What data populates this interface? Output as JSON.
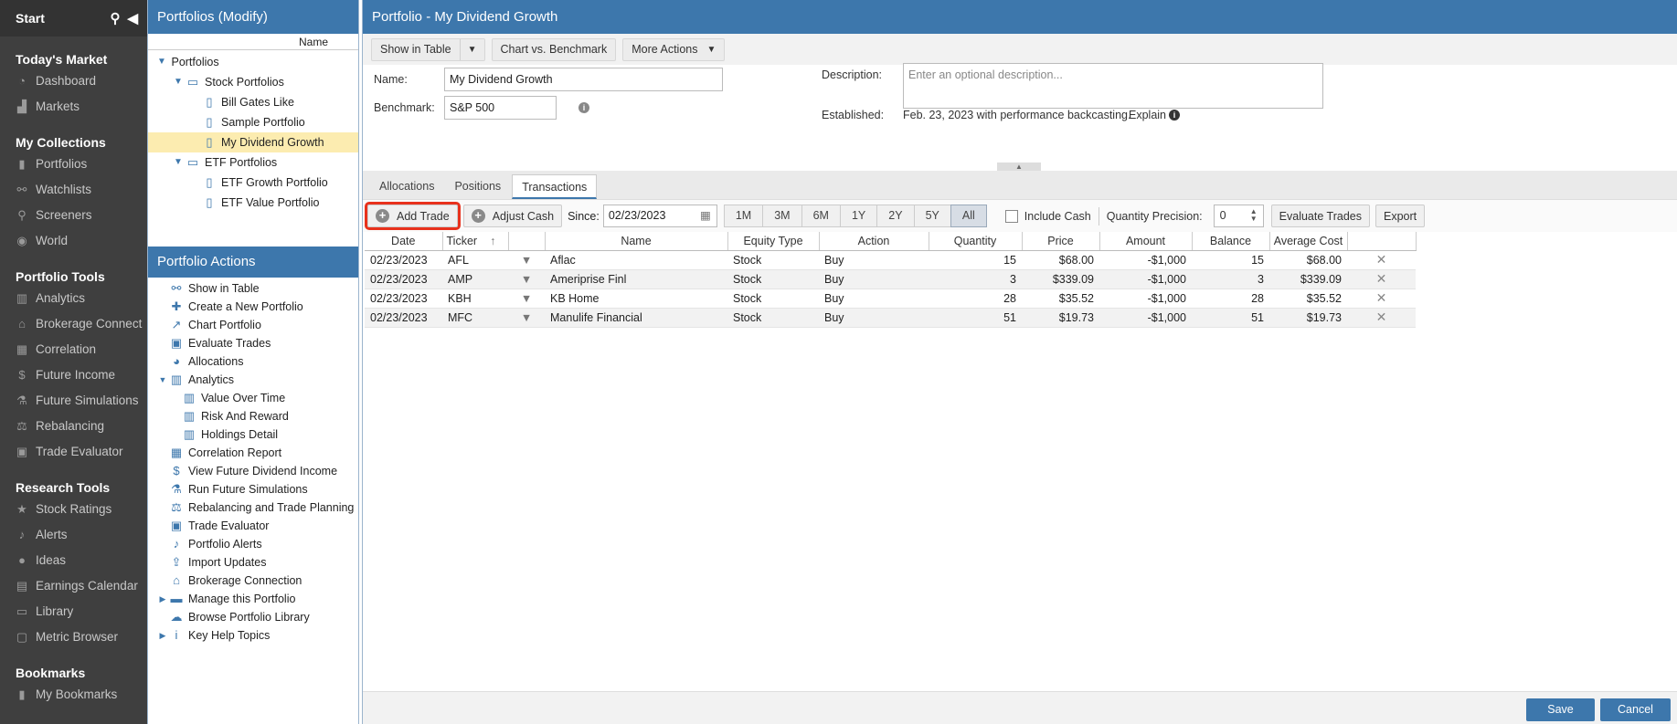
{
  "nav": {
    "start": "Start",
    "sections": [
      {
        "title": "Today's Market",
        "items": [
          {
            "label": "Dashboard",
            "icon": "dashboard-icon",
            "g": "◔"
          },
          {
            "label": "Markets",
            "icon": "markets-icon",
            "g": "▟"
          }
        ]
      },
      {
        "title": "My Collections",
        "items": [
          {
            "label": "Portfolios",
            "icon": "portfolios-icon",
            "g": "▮"
          },
          {
            "label": "Watchlists",
            "icon": "binoculars-icon",
            "g": "⚯"
          },
          {
            "label": "Screeners",
            "icon": "search-icon",
            "g": "⚲"
          },
          {
            "label": "World",
            "icon": "globe-icon",
            "g": "◉"
          }
        ]
      },
      {
        "title": "Portfolio Tools",
        "items": [
          {
            "label": "Analytics",
            "icon": "analytics-icon",
            "g": "▥"
          },
          {
            "label": "Brokerage Connect",
            "icon": "bank-icon",
            "g": "⌂"
          },
          {
            "label": "Correlation",
            "icon": "grid-icon",
            "g": "▦"
          },
          {
            "label": "Future Income",
            "icon": "dollar-icon",
            "g": "$"
          },
          {
            "label": "Future Simulations",
            "icon": "flask-icon",
            "g": "⚗"
          },
          {
            "label": "Rebalancing",
            "icon": "scale-icon",
            "g": "⚖"
          },
          {
            "label": "Trade Evaluator",
            "icon": "briefcase-icon",
            "g": "▣"
          }
        ]
      },
      {
        "title": "Research Tools",
        "items": [
          {
            "label": "Stock Ratings",
            "icon": "star-icon",
            "g": "★"
          },
          {
            "label": "Alerts",
            "icon": "bell-icon",
            "g": "♪"
          },
          {
            "label": "Ideas",
            "icon": "bulb-icon",
            "g": "●"
          },
          {
            "label": "Earnings Calendar",
            "icon": "calendar-icon",
            "g": "▤"
          },
          {
            "label": "Library",
            "icon": "library-icon",
            "g": "▭"
          },
          {
            "label": "Metric Browser",
            "icon": "browser-icon",
            "g": "▢"
          }
        ]
      },
      {
        "title": "Bookmarks",
        "items": [
          {
            "label": "My Bookmarks",
            "icon": "bookmark-icon",
            "g": "▮"
          }
        ]
      }
    ]
  },
  "tree": {
    "title": "Portfolios (Modify)",
    "col": "Name",
    "rows": [
      {
        "label": "Portfolios",
        "lvl": 0,
        "tg": "▼",
        "fi": ""
      },
      {
        "label": "Stock Portfolios",
        "lvl": 1,
        "tg": "▼",
        "fi": "folder"
      },
      {
        "label": "Bill Gates Like",
        "lvl": 2,
        "tg": "",
        "fi": "doc"
      },
      {
        "label": "Sample Portfolio",
        "lvl": 2,
        "tg": "",
        "fi": "doc"
      },
      {
        "label": "My Dividend Growth",
        "lvl": 2,
        "tg": "",
        "fi": "doc",
        "sel": true
      },
      {
        "label": "ETF Portfolios",
        "lvl": 1,
        "tg": "▼",
        "fi": "folder"
      },
      {
        "label": "ETF Growth Portfolio",
        "lvl": 2,
        "tg": "",
        "fi": "doc"
      },
      {
        "label": "ETF Value Portfolio",
        "lvl": 2,
        "tg": "",
        "fi": "doc"
      }
    ]
  },
  "actions": {
    "title": "Portfolio Actions",
    "items": [
      {
        "label": "Show in Table",
        "icon": "binoculars-icon",
        "g": "⚯",
        "lvl": 0
      },
      {
        "label": "Create a New Portfolio",
        "icon": "plus-icon",
        "g": "✚",
        "lvl": 0
      },
      {
        "label": "Chart Portfolio",
        "icon": "line-chart-icon",
        "g": "↗",
        "lvl": 0
      },
      {
        "label": "Evaluate Trades",
        "icon": "briefcase-icon",
        "g": "▣",
        "lvl": 0
      },
      {
        "label": "Allocations",
        "icon": "pie-chart-icon",
        "g": "◕",
        "lvl": 0
      },
      {
        "label": "Analytics",
        "icon": "analytics-icon",
        "g": "▥",
        "lvl": 0,
        "tg": "▼"
      },
      {
        "label": "Value Over Time",
        "icon": "bar-chart-icon",
        "g": "▥",
        "lvl": 1
      },
      {
        "label": "Risk And Reward",
        "icon": "bar-chart-icon",
        "g": "▥",
        "lvl": 1
      },
      {
        "label": "Holdings Detail",
        "icon": "bar-chart-icon",
        "g": "▥",
        "lvl": 1
      },
      {
        "label": "Correlation Report",
        "icon": "grid-icon",
        "g": "▦",
        "lvl": 0
      },
      {
        "label": "View Future Dividend Income",
        "icon": "dollar-icon",
        "g": "$",
        "lvl": 0
      },
      {
        "label": "Run Future Simulations",
        "icon": "flask-icon",
        "g": "⚗",
        "lvl": 0
      },
      {
        "label": "Rebalancing and Trade Planning",
        "icon": "scale-icon",
        "g": "⚖",
        "lvl": 0
      },
      {
        "label": "Trade Evaluator",
        "icon": "briefcase-icon",
        "g": "▣",
        "lvl": 0
      },
      {
        "label": "Portfolio Alerts",
        "icon": "bell-icon",
        "g": "♪",
        "lvl": 0
      },
      {
        "label": "Import Updates",
        "icon": "upload-icon",
        "g": "⇪",
        "lvl": 0
      },
      {
        "label": "Brokerage Connection",
        "icon": "bank-icon",
        "g": "⌂",
        "lvl": 0
      },
      {
        "label": "Manage this Portfolio",
        "icon": "folder-icon",
        "g": "▬",
        "lvl": 0,
        "tg": "▶"
      },
      {
        "label": "Browse Portfolio Library",
        "icon": "cloud-download-icon",
        "g": "☁",
        "lvl": 0
      },
      {
        "label": "Key Help Topics",
        "icon": "info-icon",
        "g": "i",
        "lvl": 0,
        "tg": "▶"
      }
    ]
  },
  "main": {
    "title": "Portfolio - My Dividend Growth",
    "toolbar": {
      "show_table": "Show in Table",
      "chart": "Chart vs. Benchmark",
      "more": "More Actions"
    },
    "form": {
      "name_label": "Name:",
      "name_value": "My Dividend Growth",
      "bench_label": "Benchmark:",
      "bench_value": "S&P 500",
      "desc_label": "Description:",
      "desc_placeholder": "Enter an optional description...",
      "est_label": "Established:",
      "est_value": "Feb. 23, 2023 with performance backcasting.",
      "explain": "Explain"
    },
    "tabs": [
      "Allocations",
      "Positions",
      "Transactions"
    ],
    "tt": {
      "add": "Add Trade",
      "adjust": "Adjust Cash",
      "since_label": "Since:",
      "since_value": "02/23/2023",
      "ranges": [
        "1M",
        "3M",
        "6M",
        "1Y",
        "2Y",
        "5Y",
        "All"
      ],
      "include_cash": "Include Cash",
      "qp_label": "Quantity Precision:",
      "qp_value": "0",
      "evaluate": "Evaluate Trades",
      "export": "Export"
    },
    "table": {
      "headers": [
        "Date",
        "Ticker",
        "",
        "Name",
        "Equity Type",
        "Action",
        "Quantity",
        "Price",
        "Amount",
        "Balance",
        "Average Cost",
        ""
      ],
      "rows": [
        [
          "02/23/2023",
          "AFL",
          "Aflac",
          "Stock",
          "Buy",
          "15",
          "$68.00",
          "-$1,000",
          "15",
          "$68.00"
        ],
        [
          "02/23/2023",
          "AMP",
          "Ameriprise Finl",
          "Stock",
          "Buy",
          "3",
          "$339.09",
          "-$1,000",
          "3",
          "$339.09"
        ],
        [
          "02/23/2023",
          "KBH",
          "KB Home",
          "Stock",
          "Buy",
          "28",
          "$35.52",
          "-$1,000",
          "28",
          "$35.52"
        ],
        [
          "02/23/2023",
          "MFC",
          "Manulife Financial",
          "Stock",
          "Buy",
          "51",
          "$19.73",
          "-$1,000",
          "51",
          "$19.73"
        ]
      ]
    },
    "save": "Save",
    "cancel": "Cancel"
  }
}
